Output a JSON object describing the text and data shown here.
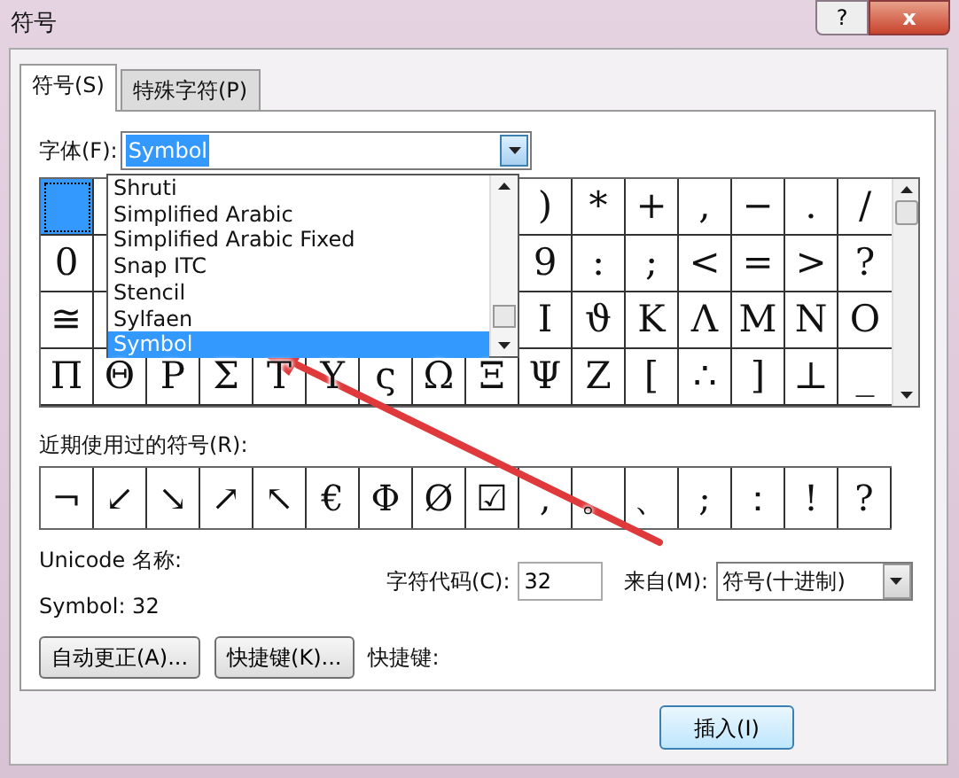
{
  "window": {
    "title": "符号",
    "help_button": "?",
    "close_button": "x"
  },
  "tabs": [
    {
      "label": "符号(S)",
      "selected": true
    },
    {
      "label": "特殊字符(P)",
      "selected": false
    }
  ],
  "font": {
    "label": "字体(F):",
    "value": "Symbol",
    "expanded": true,
    "options": [
      {
        "label": "Shruti",
        "selected": false
      },
      {
        "label": "Simplified Arabic",
        "selected": false
      },
      {
        "label": "Simplified Arabic Fixed",
        "selected": false
      },
      {
        "label": "Snap ITC",
        "selected": false
      },
      {
        "label": "Stencil",
        "selected": false
      },
      {
        "label": "Sylfaen",
        "selected": false
      },
      {
        "label": "Symbol",
        "selected": true
      }
    ]
  },
  "symbol_grid": {
    "rows": [
      {
        "cells": [
          {
            "selected": true
          },
          {
            "symbol": ")",
            "selected": false
          },
          {
            "symbol": "*",
            "selected": false
          },
          {
            "symbol": "+",
            "selected": false
          },
          {
            "symbol": ",",
            "selected": false
          },
          {
            "symbol": "−",
            "selected": false
          },
          {
            "symbol": ".",
            "selected": false
          },
          {
            "symbol": "/",
            "selected": false
          }
        ]
      },
      {
        "cells": [
          {
            "symbol": "0",
            "selected": false
          },
          {
            "symbol": "9",
            "selected": false
          },
          {
            "symbol": ":",
            "selected": false
          },
          {
            "symbol": ";",
            "selected": false
          },
          {
            "symbol": "<",
            "selected": false
          },
          {
            "symbol": "=",
            "selected": false
          },
          {
            "symbol": ">",
            "selected": false
          },
          {
            "symbol": "?",
            "selected": false
          }
        ]
      },
      {
        "cells": [
          {
            "symbol": "≅",
            "selected": false
          },
          {
            "symbol": "Ι",
            "selected": false
          },
          {
            "symbol": "ϑ",
            "selected": false
          },
          {
            "symbol": "Κ",
            "selected": false
          },
          {
            "symbol": "Λ",
            "selected": false
          },
          {
            "symbol": "Μ",
            "selected": false
          },
          {
            "symbol": "Ν",
            "selected": false
          },
          {
            "symbol": "Ο",
            "selected": false
          }
        ]
      },
      {
        "cells": [
          {
            "symbol": "Π",
            "selected": false
          },
          {
            "symbol": "Θ",
            "selected": false
          },
          {
            "symbol": "Ρ",
            "selected": false
          },
          {
            "symbol": "Σ",
            "selected": false
          },
          {
            "symbol": "Τ",
            "selected": false
          },
          {
            "symbol": "Υ",
            "selected": false
          },
          {
            "symbol": "ς",
            "selected": false
          },
          {
            "symbol": "Ω",
            "selected": false
          },
          {
            "symbol": "Ξ",
            "selected": false
          },
          {
            "symbol": "Ψ",
            "selected": false
          },
          {
            "symbol": "Ζ",
            "selected": false
          },
          {
            "symbol": "[",
            "selected": false
          },
          {
            "symbol": "∴",
            "selected": false
          },
          {
            "symbol": "]",
            "selected": false
          },
          {
            "symbol": "⊥",
            "selected": false
          },
          {
            "symbol": "_",
            "selected": false
          }
        ]
      }
    ]
  },
  "recent": {
    "label": "近期使用过的符号(R):",
    "symbols": [
      "¬",
      "↙",
      "↘",
      "↗",
      "↖",
      "€",
      "Φ",
      "Ø",
      "☑",
      ",",
      "。",
      "、",
      ";",
      "：",
      "!",
      "?"
    ]
  },
  "unicode_name": {
    "label": "Unicode 名称:",
    "value": "Symbol: 32"
  },
  "char_code": {
    "label": "字符代码(C):",
    "value": "32"
  },
  "from": {
    "label": "来自(M):",
    "value": "符号(十进制)"
  },
  "buttons": [
    {
      "label": "自动更正(A)..."
    },
    {
      "label": "快捷键(K)..."
    }
  ],
  "shortcut_label": "快捷键:",
  "insert_button": "插入(I)"
}
